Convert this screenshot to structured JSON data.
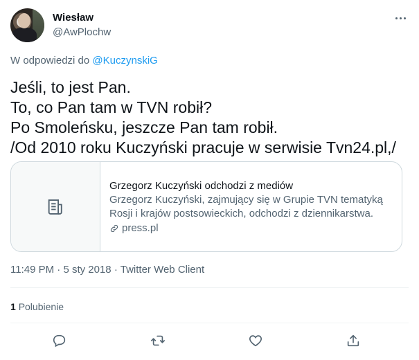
{
  "tweet": {
    "author_name": "Wiesław",
    "author_handle": "@AwPlochw",
    "reply_prefix": "W odpowiedzi do",
    "reply_to": "@KuczynskiG",
    "lines": [
      "Jeśli, to jest Pan.",
      "To, co Pan tam w TVN robił?",
      "Po Smoleńsku, jeszcze Pan tam robił.",
      "/Od 2010 roku Kuczyński pracuje w serwisie Tvn24.pl,/"
    ],
    "time": "11:49 PM",
    "date": "5 sty 2018",
    "separator": "·",
    "client": "Twitter Web Client"
  },
  "card": {
    "title": "Grzegorz Kuczyński odchodzi z mediów",
    "description": "Grzegorz Kuczyński, zajmujący się w Grupie TVN tematyką Rosji i krajów postsowieckich, odchodzi z dziennikarstwa.",
    "domain": "press.pl",
    "thumb_icon": "article-icon",
    "link_icon": "link-icon"
  },
  "stats": {
    "likes_count": "1",
    "likes_label": "Polubienie"
  },
  "actions": {
    "icons": [
      "reply-icon",
      "retweet-icon",
      "like-icon",
      "share-icon"
    ]
  },
  "colors": {
    "text": "#0f1419",
    "secondary": "#536471",
    "link": "#1d9bf0",
    "border": "#cfd9de"
  }
}
